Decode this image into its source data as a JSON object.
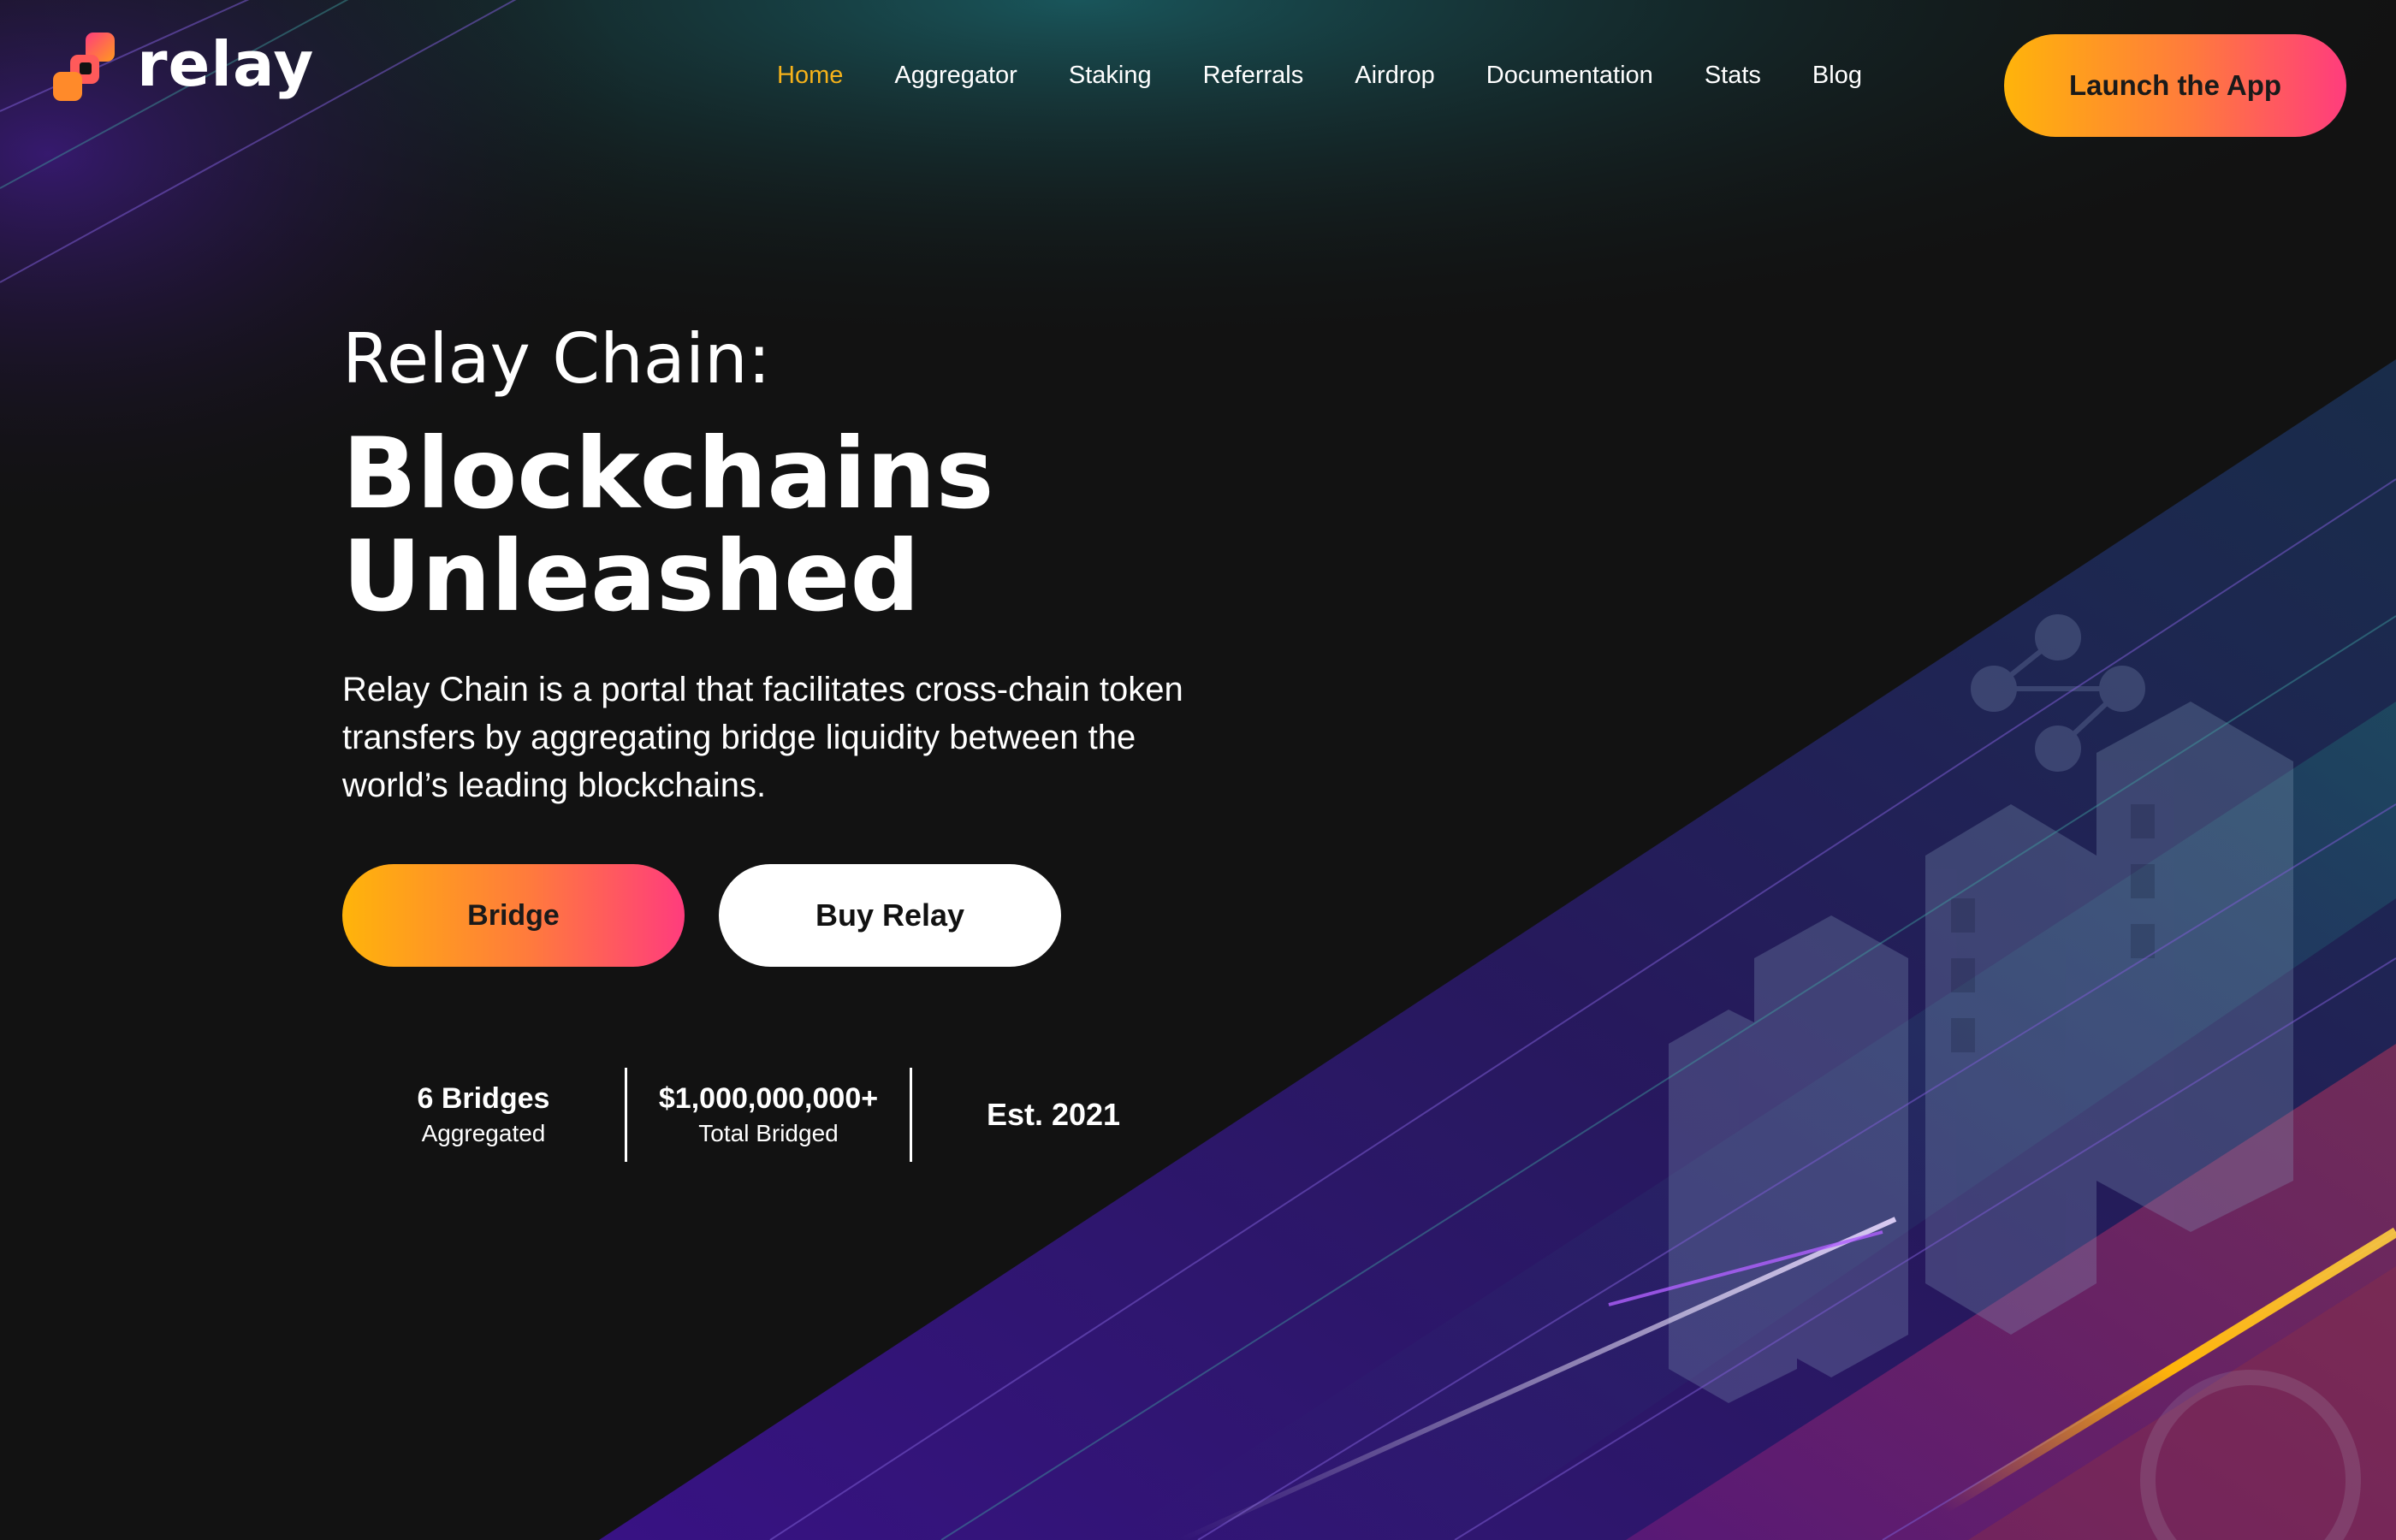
{
  "brand": {
    "name": "relay",
    "logo_colors": [
      "#ff3c7d",
      "#ff9a1f"
    ]
  },
  "nav": {
    "items": [
      {
        "label": "Home",
        "active": true
      },
      {
        "label": "Aggregator"
      },
      {
        "label": "Staking"
      },
      {
        "label": "Referrals"
      },
      {
        "label": "Airdrop"
      },
      {
        "label": "Documentation"
      },
      {
        "label": "Stats"
      },
      {
        "label": "Blog"
      }
    ],
    "launch_label": "Launch the App"
  },
  "hero": {
    "kicker": "Relay Chain:",
    "title_line1": "Blockchains",
    "title_line2": "Unleashed",
    "description": "Relay Chain is a portal that facilitates cross-chain token transfers by aggregating bridge liquidity between the world’s leading blockchains.",
    "buttons": {
      "bridge": "Bridge",
      "buy": "Buy Relay"
    }
  },
  "stats": [
    {
      "value": "6 Bridges",
      "label": "Aggregated"
    },
    {
      "value": "$1,000,000,000+",
      "label": "Total Bridged"
    },
    {
      "value": "Est. 2021"
    }
  ],
  "colors": {
    "accent_active": "#f6b21a",
    "gradient_start": "#ffb40a",
    "gradient_end": "#ff3c7d",
    "background": "#121212",
    "purple_glow": "#5a1fa8",
    "teal_glow": "#1f6b6b"
  }
}
